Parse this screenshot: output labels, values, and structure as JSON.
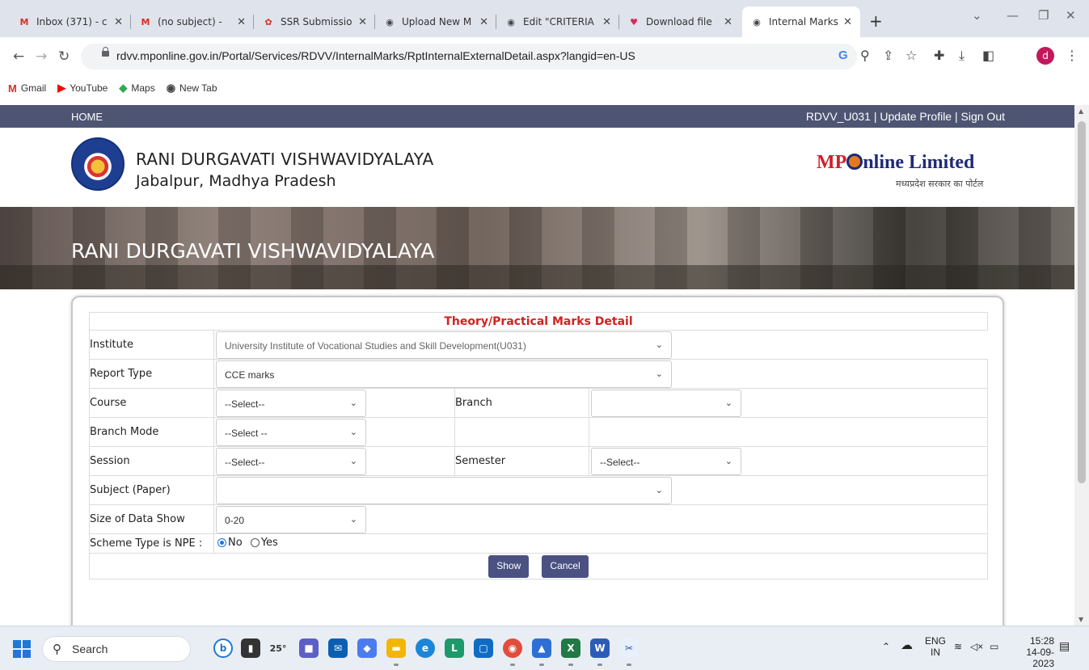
{
  "browser": {
    "tabs": [
      {
        "title": "Inbox (371) - c",
        "icon": "gmail-icon",
        "favicon_text": "M",
        "color": "#d93025"
      },
      {
        "title": "(no subject) -",
        "icon": "gmail-icon",
        "favicon_text": "M",
        "color": "#d93025"
      },
      {
        "title": "SSR Submissio",
        "icon": "ssr-icon",
        "favicon_text": "✿",
        "color": "#d93025"
      },
      {
        "title": "Upload New M",
        "icon": "globe-icon",
        "favicon_text": "◉",
        "color": "#444"
      },
      {
        "title": "Edit \"CRITERIA",
        "icon": "globe-icon",
        "favicon_text": "◉",
        "color": "#444"
      },
      {
        "title": "Download file",
        "icon": "heart-icon",
        "favicon_text": "♥",
        "color": "#e0245e"
      },
      {
        "title": "Internal Marks",
        "icon": "globe-icon",
        "favicon_text": "◉",
        "color": "#444"
      }
    ],
    "url": "rdvv.mponline.gov.in/Portal/Services/RDVV/InternalMarks/RptInternalExternalDetail.aspx?langid=en-US",
    "profile_initial": "d",
    "bookmarks": [
      {
        "label": "Gmail",
        "icon": "gmail-icon",
        "glyph": "M",
        "color": "#d93025"
      },
      {
        "label": "YouTube",
        "icon": "youtube-icon",
        "glyph": "▶",
        "color": "#ff0000"
      },
      {
        "label": "Maps",
        "icon": "maps-icon",
        "glyph": "◆",
        "color": "#34a853"
      },
      {
        "label": "New Tab",
        "icon": "globe-icon",
        "glyph": "◉",
        "color": "#444"
      }
    ]
  },
  "page": {
    "nav_home": "HOME",
    "nav_user": "RDVV_U031 | Update Profile | Sign Out",
    "univ_name": "RANI DURGAVATI VISHWAVIDYALAYA",
    "univ_place": "Jabalpur, Madhya Pradesh",
    "mpo_brand_mp": "MP",
    "mpo_brand_rest": "nline Limited",
    "mpo_sub": "मध्यप्रदेश सरकार का पोर्टल",
    "banner_title": "RANI DURGAVATI VISHWAVIDYALAYA",
    "form": {
      "caption": "Theory/Practical Marks Detail",
      "institute_label": "Institute",
      "institute_value": "University Institute of Vocational Studies and Skill Development(U031)",
      "report_type_label": "Report Type",
      "report_type_value": "CCE marks",
      "course_label": "Course",
      "course_value": "--Select--",
      "branch_label": "Branch",
      "branch_value": "",
      "branch_mode_label": "Branch Mode",
      "branch_mode_value": "--Select --",
      "session_label": "Session",
      "session_value": "--Select--",
      "semester_label": "Semester",
      "semester_value": "--Select--",
      "subject_label": "Subject (Paper)",
      "subject_value": "",
      "size_label": "Size of Data Show",
      "size_value": "0-20",
      "scheme_label": "Scheme Type is NPE :",
      "scheme_no": "No",
      "scheme_yes": "Yes",
      "show_button": "Show",
      "cancel_button": "Cancel"
    }
  },
  "taskbar": {
    "search_placeholder": "Search",
    "weather": "25°",
    "lang_top": "ENG",
    "lang_bottom": "IN",
    "time": "15:28",
    "date": "14-09-2023"
  }
}
